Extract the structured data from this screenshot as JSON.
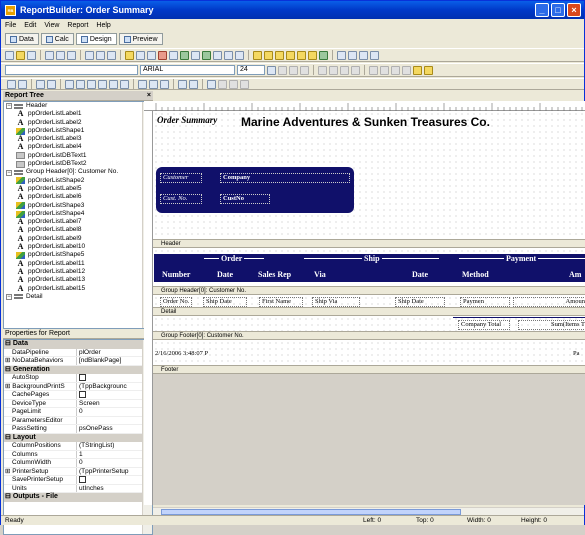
{
  "window": {
    "title": "ReportBuilder: Order Summary",
    "app_icon": "RB"
  },
  "menu": [
    "File",
    "Edit",
    "View",
    "Report",
    "Help"
  ],
  "tabs": [
    {
      "label": "Data"
    },
    {
      "label": "Calc"
    },
    {
      "label": "Design"
    },
    {
      "label": "Preview"
    }
  ],
  "format": {
    "font": "ARIAL",
    "size": "24"
  },
  "left": {
    "tree_title": "Report Tree",
    "tree": [
      {
        "level": 0,
        "kind": "band",
        "label": "Header"
      },
      {
        "level": 1,
        "kind": "label",
        "label": "ppOrderListLabel1"
      },
      {
        "level": 1,
        "kind": "label",
        "label": "ppOrderListLabel2"
      },
      {
        "level": 1,
        "kind": "shape",
        "label": "ppOrderListShape1"
      },
      {
        "level": 1,
        "kind": "label",
        "label": "ppOrderListLabel3"
      },
      {
        "level": 1,
        "kind": "label",
        "label": "ppOrderListLabel4"
      },
      {
        "level": 1,
        "kind": "db",
        "label": "ppOrderListDBText1"
      },
      {
        "level": 1,
        "kind": "db",
        "label": "ppOrderListDBText2"
      },
      {
        "level": 0,
        "kind": "band",
        "label": "Group Header[0]: Customer No."
      },
      {
        "level": 1,
        "kind": "shape",
        "label": "ppOrderListShape2"
      },
      {
        "level": 1,
        "kind": "label",
        "label": "ppOrderListLabel5"
      },
      {
        "level": 1,
        "kind": "label",
        "label": "ppOrderListLabel6"
      },
      {
        "level": 1,
        "kind": "shape",
        "label": "ppOrderListShape3"
      },
      {
        "level": 1,
        "kind": "shape",
        "label": "ppOrderListShape4"
      },
      {
        "level": 1,
        "kind": "label",
        "label": "ppOrderListLabel7"
      },
      {
        "level": 1,
        "kind": "label",
        "label": "ppOrderListLabel8"
      },
      {
        "level": 1,
        "kind": "label",
        "label": "ppOrderListLabel9"
      },
      {
        "level": 1,
        "kind": "label",
        "label": "ppOrderListLabel10"
      },
      {
        "level": 1,
        "kind": "shape",
        "label": "ppOrderListShape5"
      },
      {
        "level": 1,
        "kind": "label",
        "label": "ppOrderListLabel11"
      },
      {
        "level": 1,
        "kind": "label",
        "label": "ppOrderListLabel12"
      },
      {
        "level": 1,
        "kind": "label",
        "label": "ppOrderListLabel13"
      },
      {
        "level": 1,
        "kind": "label",
        "label": "ppOrderListLabel15"
      },
      {
        "level": 0,
        "kind": "band",
        "label": "Detail"
      }
    ],
    "props_title": "Properties for Report",
    "props": [
      {
        "cat": "Data"
      },
      {
        "name": "DataPipeline",
        "value": "plOrder"
      },
      {
        "name": "NoDataBehaviors",
        "value": "[ndBlankPage]",
        "expand": true
      },
      {
        "cat": "Generation"
      },
      {
        "name": "AutoStop",
        "value": "",
        "check": true
      },
      {
        "name": "BackgroundPrintS",
        "value": "(TppBackgrounc",
        "expand": true
      },
      {
        "name": "CachePages",
        "value": "",
        "check": true
      },
      {
        "name": "DeviceType",
        "value": "Screen"
      },
      {
        "name": "PageLimit",
        "value": "0"
      },
      {
        "name": "ParametersEditor",
        "value": ""
      },
      {
        "name": "PassSetting",
        "value": "psOnePass"
      },
      {
        "cat": "Layout"
      },
      {
        "name": "ColumnPositions",
        "value": "(TStringList)"
      },
      {
        "name": "Columns",
        "value": "1"
      },
      {
        "name": "ColumnWidth",
        "value": "0"
      },
      {
        "name": "PrinterSetup",
        "value": "(TppPrinterSetup",
        "expand": true
      },
      {
        "name": "SavePrinterSetup",
        "value": "",
        "check": true
      },
      {
        "name": "Units",
        "value": "utInches"
      },
      {
        "cat": "Outputs - File"
      }
    ]
  },
  "design": {
    "header": {
      "order_summary": "Order Summary",
      "company_title": "Marine Adventures & Sunken Treasures Co.",
      "customer_label": "Customer",
      "company_field": "Company",
      "custno_label": "Cust. No.",
      "custno_field": "CustNo"
    },
    "bands": {
      "header": "Header",
      "group_header": "Group Header[0]: Customer No.",
      "detail": "Detail",
      "group_footer": "Group Footer[0]: Customer No.",
      "footer": "Footer"
    },
    "group_header": {
      "col_groups": [
        "Order",
        "Ship",
        "Payment"
      ],
      "cols": [
        "Number",
        "Date",
        "Sales Rep",
        "Via",
        "Date",
        "Method",
        "Am"
      ]
    },
    "detail": [
      "Order No.",
      "Ship Date",
      "First Name",
      "Ship Via",
      "Ship Date",
      "Paymen",
      "Amoun"
    ],
    "group_footer": [
      "Company Total",
      "Sum(Items T"
    ],
    "footer": {
      "date": "2/16/2006 3:48:07 P",
      "page": "Pa"
    }
  },
  "status": {
    "text": "Ready",
    "left": "Left: 0",
    "top": "Top: 0",
    "width": "Width: 0",
    "height": "Height: 0"
  }
}
